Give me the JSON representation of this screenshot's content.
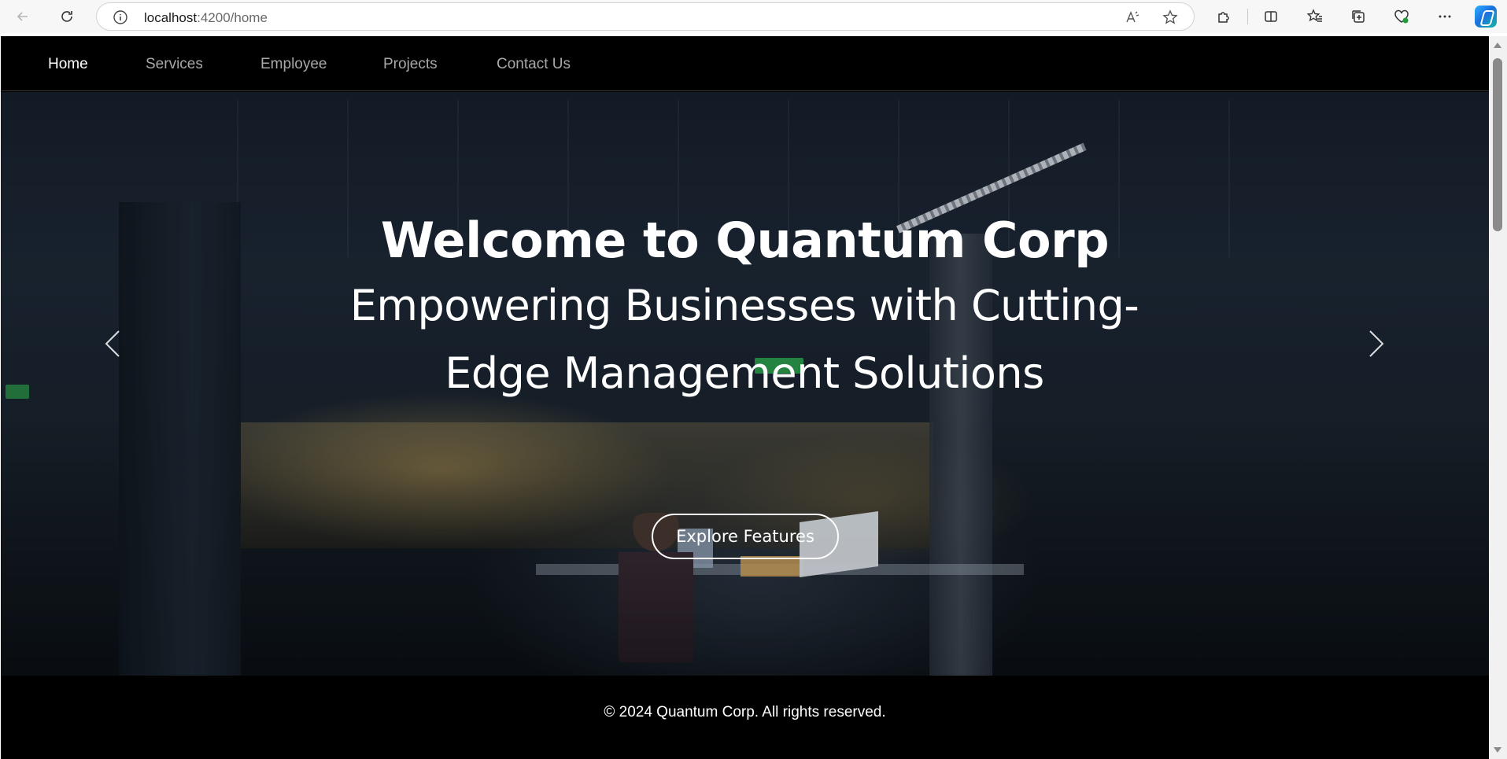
{
  "browser": {
    "url_host": "localhost",
    "url_path": ":4200/home",
    "icons": {
      "back": "arrow-left-icon",
      "refresh": "refresh-icon",
      "site_info": "info-icon",
      "read_aloud": "read-aloud-icon",
      "favorite": "star-icon",
      "extensions": "puzzle-icon",
      "split_screen": "split-screen-icon",
      "favorites": "favorites-icon",
      "collections": "collections-icon",
      "browser_essentials": "heart-pulse-icon",
      "more": "more-icon",
      "copilot": "copilot-icon"
    }
  },
  "nav": {
    "items": [
      {
        "label": "Home",
        "active": true
      },
      {
        "label": "Services",
        "active": false
      },
      {
        "label": "Employee",
        "active": false
      },
      {
        "label": "Projects",
        "active": false
      },
      {
        "label": "Contact Us",
        "active": false
      }
    ]
  },
  "hero": {
    "title": "Welcome to Quantum Corp",
    "subtitle": "Empowering Businesses with Cutting-Edge Management Solutions",
    "cta_label": "Explore Features",
    "slides_count": 2,
    "active_slide": 1
  },
  "footer": {
    "text": "© 2024 Quantum Corp. All rights reserved."
  },
  "colors": {
    "nav_bg": "#000000",
    "nav_active": "#ffffff",
    "nav_inactive": "#a8a8a8",
    "footer_bg": "#000000",
    "text_on_dark": "#ffffff"
  }
}
